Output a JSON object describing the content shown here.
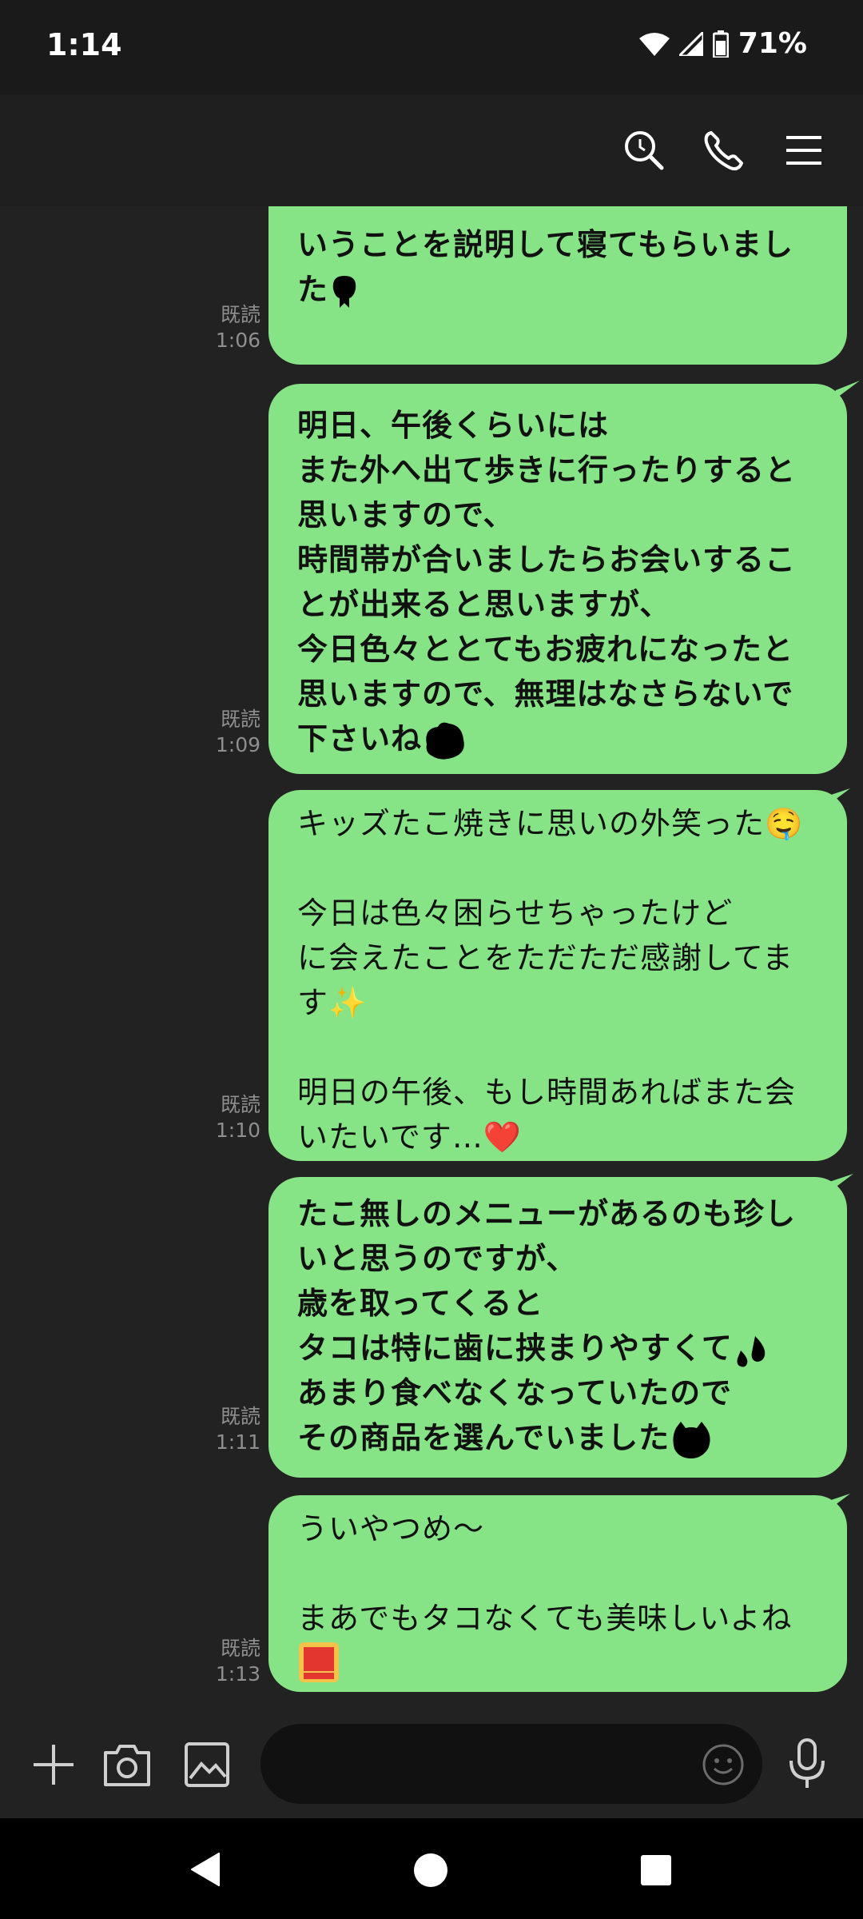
{
  "status_bar": {
    "time": "1:14",
    "battery": "71%"
  },
  "header": {
    "icons": [
      "search-icon",
      "phone-icon",
      "menu-icon"
    ]
  },
  "messages": [
    {
      "read": "既読",
      "time": "1:06",
      "lines": [
        "いうことを説明して寝てもらいまし",
        "た"
      ]
    },
    {
      "read": "既読",
      "time": "1:09",
      "lines": [
        "明日、午後くらいには",
        "また外へ出て歩きに行ったりすると",
        "思いますので、",
        "時間帯が合いましたらお会いするこ",
        "とが出来ると思いますが、",
        "今日色々ととてもお疲れになったと",
        "思いますので、無理はなさらないで",
        "下さいね"
      ]
    },
    {
      "read": "既読",
      "time": "1:10",
      "lines": [
        "キッズたこ焼きに思いの外笑った🤤",
        "",
        "今日は色々困らせちゃったけど",
        "に会えたことをただただ感謝してま",
        "す✨",
        "",
        "明日の午後、もし時間あればまた会",
        "いたいです…❤️"
      ]
    },
    {
      "read": "既読",
      "time": "1:11",
      "lines": [
        "たこ無しのメニューがあるのも珍し",
        "いと思うのですが、",
        "歳を取ってくると",
        "タコは特に歯に挟まりやすくて",
        "あまり食べなくなっていたので",
        "その商品を選んでいました"
      ]
    },
    {
      "read": "既読",
      "time": "1:13",
      "lines": [
        "ういやつめ〜",
        "",
        "まあでもタコなくても美味しいよね"
      ]
    }
  ],
  "input": {
    "placeholder": ""
  },
  "colors": {
    "bubble": "#86e487",
    "background": "#222222",
    "header": "#1f1f1f"
  }
}
